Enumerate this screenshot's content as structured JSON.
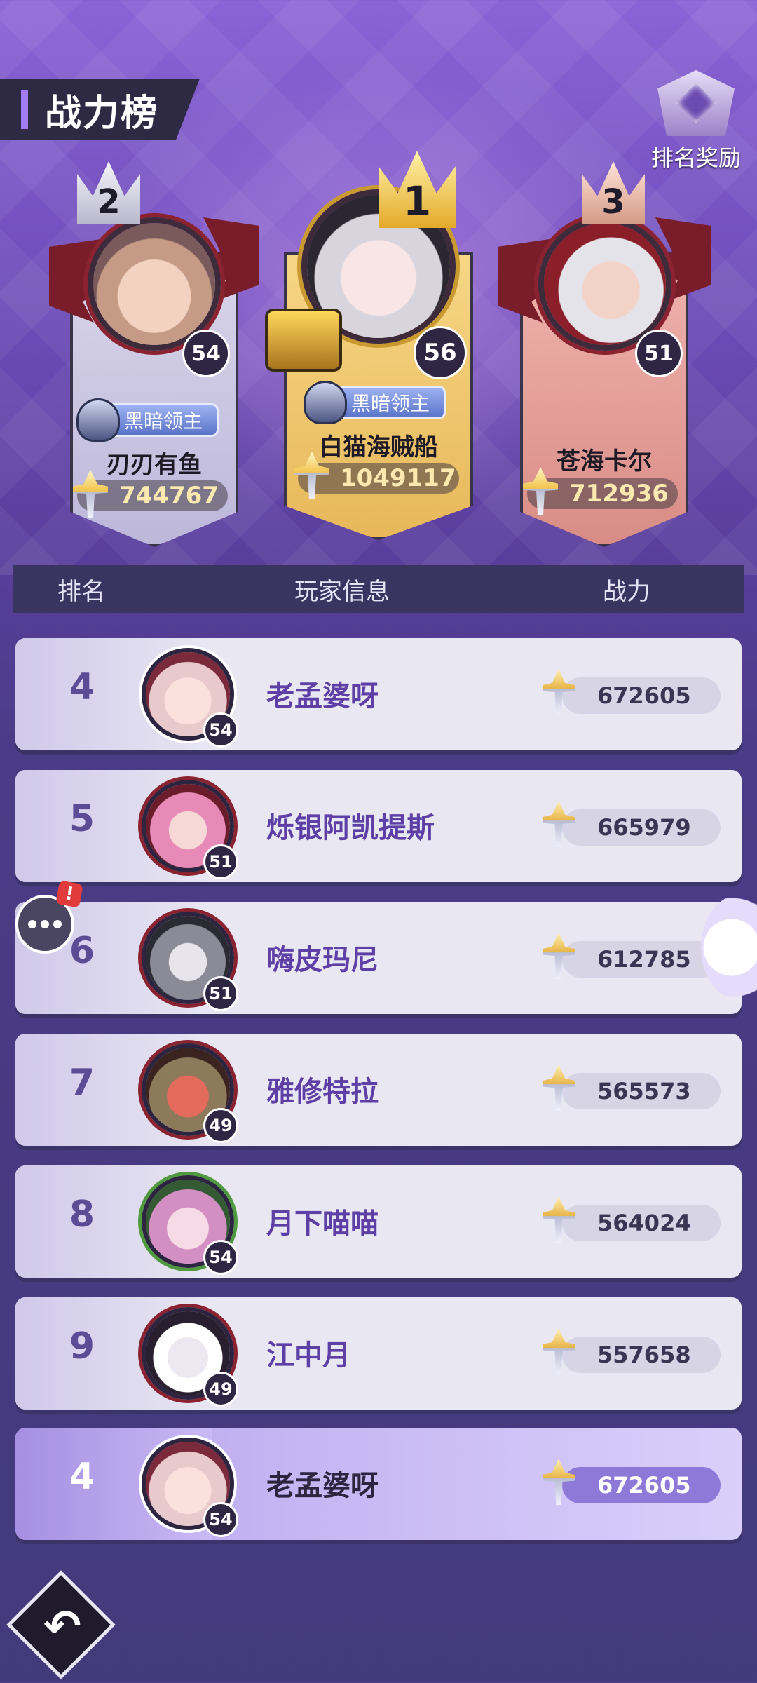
{
  "header": {
    "title": "战力榜",
    "reward_label": "排名奖励"
  },
  "podium": [
    {
      "rank": "2",
      "level": "54",
      "badge": "黑暗领主",
      "name": "刃刃有鱼",
      "power": "744767"
    },
    {
      "rank": "1",
      "level": "56",
      "badge": "黑暗领主",
      "name": "白猫海贼船",
      "power": "1049117"
    },
    {
      "rank": "3",
      "level": "51",
      "badge": "",
      "name": "苍海卡尔",
      "power": "712936"
    }
  ],
  "columns": {
    "rank": "排名",
    "player": "玩家信息",
    "power": "战力"
  },
  "rows": [
    {
      "rank": "4",
      "level": "54",
      "name": "老孟婆呀",
      "power": "672605"
    },
    {
      "rank": "5",
      "level": "51",
      "name": "烁银阿凯提斯",
      "power": "665979"
    },
    {
      "rank": "6",
      "level": "51",
      "name": "嗨皮玛尼",
      "power": "612785"
    },
    {
      "rank": "7",
      "level": "49",
      "name": "雅修特拉",
      "power": "565573"
    },
    {
      "rank": "8",
      "level": "54",
      "name": "月下喵喵",
      "power": "564024"
    },
    {
      "rank": "9",
      "level": "49",
      "name": "江中月",
      "power": "557658"
    }
  ],
  "my_rank": {
    "rank": "4",
    "level": "54",
    "name": "老孟婆呀",
    "power": "672605"
  },
  "chat": {
    "alert": "!"
  },
  "icons": {
    "reward": "reward-emblem-icon",
    "power": "sword-icon",
    "chat": "chat-bubble-icon",
    "back": "back-arrow-icon"
  },
  "colors": {
    "accent": "#a17cf2",
    "name_text": "#5d3fa6",
    "row_bg": "#e8e7f2"
  }
}
